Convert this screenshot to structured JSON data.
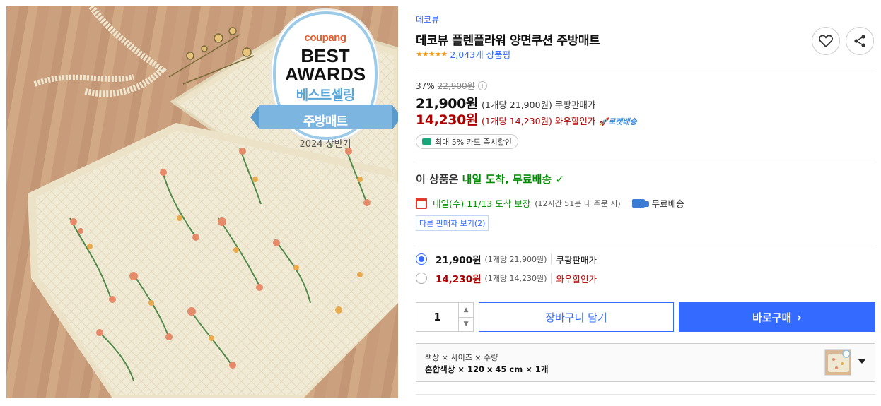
{
  "badge": {
    "brand": "coupang",
    "line1": "BEST",
    "line2": "AWARDS",
    "subtitle": "베스트셀링",
    "ribbon": "주방매트",
    "period": "2024 상반기"
  },
  "product": {
    "brand": "데코뷰",
    "title": "데코뷰 플렌플라워 양면쿠션 주방매트",
    "stars": "★★★★★",
    "review_count": "2,043개 상품평"
  },
  "pricing": {
    "discount": "37%",
    "original_price": "22,900원",
    "info_icon": "info-icon",
    "coupang_price": "21,900원",
    "coupang_unit": "(1개당 21,900원)",
    "coupang_label": "쿠팡판매가",
    "wow_price": "14,230원",
    "wow_unit": "(1개당 14,230원)",
    "wow_label": "와우할인가",
    "rocket_label": "🚀로켓배송",
    "card_promo": "최대 5% 카드 즉시할인"
  },
  "delivery": {
    "head_prefix": "이 상품은 ",
    "head_green": "내일 도착, 무료배송",
    "head_check": "✓",
    "arrival_green": "내일(수) 11/13 도착 보장",
    "arrival_note": "(12시간 51분 내 주문 시)",
    "free_shipping": "무료배송",
    "other_sellers": "다른 판매자 보기(2)"
  },
  "options": [
    {
      "price": "21,900원",
      "unit": "(1개당 21,900원)",
      "label": "쿠팡판매가",
      "selected": true
    },
    {
      "price": "14,230원",
      "unit": "(1개당 14,230원)",
      "label": "와우할인가",
      "selected": false
    }
  ],
  "purchase": {
    "quantity": "1",
    "qty_up": "▲",
    "qty_down": "▼",
    "cart_label": "장바구니 담기",
    "buy_label": "바로구매",
    "buy_arrow": "›"
  },
  "option_select": {
    "header": "색상 × 사이즈 × 수량",
    "value": "혼합색상 × 120 x 45 cm × 1개"
  },
  "colors": {
    "accent": "#346aff",
    "wow_red": "#ae0000",
    "delivery_green": "#008c00",
    "star": "#f59a1b"
  }
}
